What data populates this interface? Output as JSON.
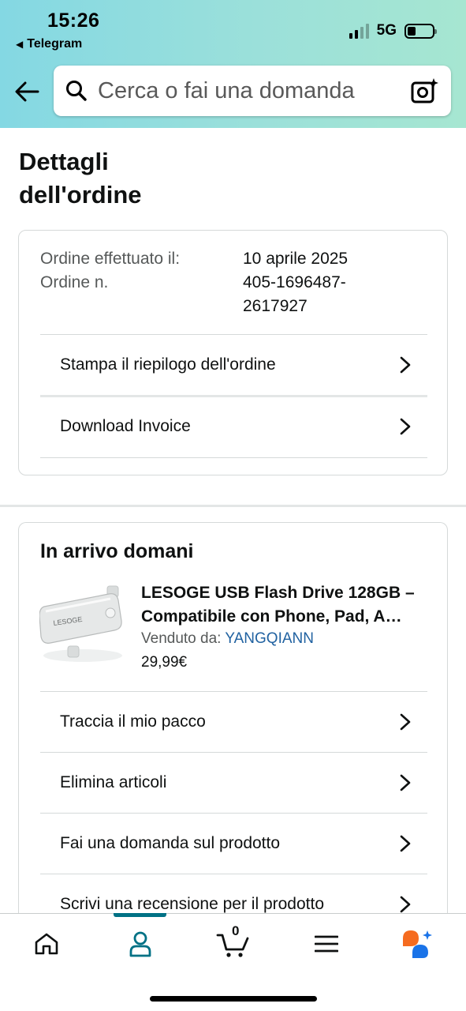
{
  "status_bar": {
    "time": "15:26",
    "back_app": "Telegram",
    "network": "5G"
  },
  "header": {
    "search_placeholder": "Cerca o fai una domanda"
  },
  "page_title": "Dettagli dell'ordine",
  "order_summary": {
    "placed_label": "Ordine effettuato il:",
    "placed_value": "10 aprile 2025",
    "number_label": "Ordine n.",
    "number_value": "405-1696487-2617927",
    "actions": [
      {
        "label": "Stampa il riepilogo dell'ordine"
      },
      {
        "label": "Download Invoice"
      }
    ]
  },
  "shipment": {
    "heading": "In arrivo domani",
    "product": {
      "image_brand": "LESOGE",
      "title_line1": "LESOGE USB Flash Drive 128GB –",
      "title_line2": "Compatibile con Phone, Pad, A…",
      "sold_by_label": "Venduto da:",
      "seller": "YANGQIANN",
      "price": "29,99€"
    },
    "actions": [
      {
        "label": "Traccia il mio pacco"
      },
      {
        "label": "Elimina articoli"
      },
      {
        "label": "Fai una domanda sul prodotto"
      },
      {
        "label": "Scrivi una recensione per il prodotto"
      }
    ]
  },
  "bottom_nav": {
    "cart_count": "0",
    "items": [
      "home-icon",
      "account-icon",
      "cart-icon",
      "menu-icon",
      "assistant-icon"
    ],
    "accent_color": "#007185"
  },
  "colors": {
    "header_gradient_start": "#84d8e3",
    "header_gradient_end": "#a6e6d1",
    "link": "#2162a1",
    "assistant_orange": "#f56b1f",
    "assistant_blue": "#1a73e8"
  }
}
